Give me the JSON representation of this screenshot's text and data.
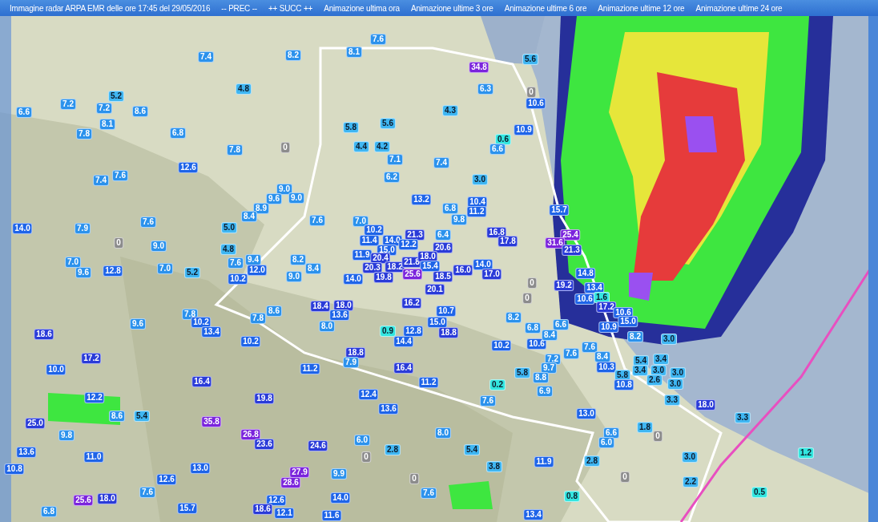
{
  "header": {
    "title": "Immagine radar ARPA EMR delle ore 17:45 del 29/05/2016",
    "links": [
      {
        "label": "-- PREC --"
      },
      {
        "label": "++ SUCC ++"
      },
      {
        "label": "Animazione ultima ora"
      },
      {
        "label": "Animazione ultime 3 ore"
      },
      {
        "label": "Animazione ultime 6 ore"
      },
      {
        "label": "Animazione ultime 12 ore"
      },
      {
        "label": "Animazione ultime 24 ore"
      }
    ]
  },
  "map": {
    "kind": "picture",
    "gauges": [
      {
        "value": "7.6",
        "color": "#2c92ec"
      },
      {
        "value": "7.4",
        "color": "#2c92ec"
      },
      {
        "value": "8.2",
        "color": "#2c92ec"
      },
      {
        "value": "8.1",
        "color": "#2c92ec"
      },
      {
        "value": "5.6",
        "color": "#3fb6f2"
      },
      {
        "value": "34.8",
        "color": "#7b24dc"
      },
      {
        "value": "5.2",
        "color": "#3fb6f2"
      },
      {
        "value": "4.8",
        "color": "#3fb6f2"
      },
      {
        "value": "6.3",
        "color": "#2c92ec"
      },
      {
        "value": "0",
        "color": "#8c8c8c"
      },
      {
        "value": "6.6",
        "color": "#2c92ec"
      },
      {
        "value": "7.2",
        "color": "#2c92ec"
      },
      {
        "value": "7.2",
        "color": "#2c92ec"
      },
      {
        "value": "8.6",
        "color": "#2c92ec"
      },
      {
        "value": "4.3",
        "color": "#3fb6f2"
      },
      {
        "value": "10.6",
        "color": "#1e64e8"
      },
      {
        "value": "7.8",
        "color": "#2c92ec"
      },
      {
        "value": "8.1",
        "color": "#2c92ec"
      },
      {
        "value": "6.8",
        "color": "#2c92ec"
      },
      {
        "value": "5.8",
        "color": "#3fb6f2"
      },
      {
        "value": "5.6",
        "color": "#3fb6f2"
      },
      {
        "value": "0.6",
        "color": "#33e6e0"
      },
      {
        "value": "10.9",
        "color": "#1e64e8"
      },
      {
        "value": "7.8",
        "color": "#2c92ec"
      },
      {
        "value": "0",
        "color": "#8c8c8c"
      },
      {
        "value": "4.4",
        "color": "#3fb6f2"
      },
      {
        "value": "4.2",
        "color": "#3fb6f2"
      },
      {
        "value": "6.6",
        "color": "#2c92ec"
      },
      {
        "value": "12.6",
        "color": "#1e64e8"
      },
      {
        "value": "7.1",
        "color": "#2c92ec"
      },
      {
        "value": "7.4",
        "color": "#2c92ec"
      },
      {
        "value": "7.4",
        "color": "#2c92ec"
      },
      {
        "value": "7.6",
        "color": "#2c92ec"
      },
      {
        "value": "6.2",
        "color": "#2c92ec"
      },
      {
        "value": "3.0",
        "color": "#3fb6f2"
      },
      {
        "value": "9.0",
        "color": "#2c92ec"
      },
      {
        "value": "9.6",
        "color": "#2c92ec"
      },
      {
        "value": "9.0",
        "color": "#2c92ec"
      },
      {
        "value": "13.2",
        "color": "#1e64e8"
      },
      {
        "value": "10.4",
        "color": "#1e64e8"
      },
      {
        "value": "8.9",
        "color": "#2c92ec"
      },
      {
        "value": "6.8",
        "color": "#2c92ec"
      },
      {
        "value": "11.2",
        "color": "#1e64e8"
      },
      {
        "value": "15.7",
        "color": "#1e64e8"
      },
      {
        "value": "7.6",
        "color": "#2c92ec"
      },
      {
        "value": "8.4",
        "color": "#2c92ec"
      },
      {
        "value": "7.6",
        "color": "#2c92ec"
      },
      {
        "value": "7.0",
        "color": "#2c92ec"
      },
      {
        "value": "9.8",
        "color": "#2c92ec"
      },
      {
        "value": "14.0",
        "color": "#1e64e8"
      },
      {
        "value": "7.9",
        "color": "#2c92ec"
      },
      {
        "value": "5.0",
        "color": "#3fb6f2"
      },
      {
        "value": "10.2",
        "color": "#1e64e8"
      },
      {
        "value": "21.3",
        "color": "#2a3bd8"
      },
      {
        "value": "6.4",
        "color": "#2c92ec"
      },
      {
        "value": "16.8",
        "color": "#2a3bd8"
      },
      {
        "value": "25.4",
        "color": "#7b24dc"
      },
      {
        "value": "0",
        "color": "#8c8c8c"
      },
      {
        "value": "9.0",
        "color": "#2c92ec"
      },
      {
        "value": "4.8",
        "color": "#3fb6f2"
      },
      {
        "value": "11.4",
        "color": "#1e64e8"
      },
      {
        "value": "14.0",
        "color": "#1e64e8"
      },
      {
        "value": "15.0",
        "color": "#1e64e8"
      },
      {
        "value": "12.2",
        "color": "#1e64e8"
      },
      {
        "value": "20.6",
        "color": "#2a3bd8"
      },
      {
        "value": "17.8",
        "color": "#2a3bd8"
      },
      {
        "value": "31.6",
        "color": "#7b24dc"
      },
      {
        "value": "21.3",
        "color": "#2a3bd8"
      },
      {
        "value": "7.0",
        "color": "#2c92ec"
      },
      {
        "value": "7.6",
        "color": "#2c92ec"
      },
      {
        "value": "9.4",
        "color": "#2c92ec"
      },
      {
        "value": "8.2",
        "color": "#2c92ec"
      },
      {
        "value": "11.9",
        "color": "#1e64e8"
      },
      {
        "value": "20.4",
        "color": "#2a3bd8"
      },
      {
        "value": "20.3",
        "color": "#2a3bd8"
      },
      {
        "value": "18.2",
        "color": "#2a3bd8"
      },
      {
        "value": "21.8",
        "color": "#2a3bd8"
      },
      {
        "value": "18.0",
        "color": "#2a3bd8"
      },
      {
        "value": "15.4",
        "color": "#1e64e8"
      },
      {
        "value": "14.0",
        "color": "#1e64e8"
      },
      {
        "value": "9.6",
        "color": "#2c92ec"
      },
      {
        "value": "12.8",
        "color": "#1e64e8"
      },
      {
        "value": "7.0",
        "color": "#2c92ec"
      },
      {
        "value": "5.2",
        "color": "#3fb6f2"
      },
      {
        "value": "12.0",
        "color": "#1e64e8"
      },
      {
        "value": "10.2",
        "color": "#1e64e8"
      },
      {
        "value": "9.0",
        "color": "#2c92ec"
      },
      {
        "value": "8.4",
        "color": "#2c92ec"
      },
      {
        "value": "14.0",
        "color": "#1e64e8"
      },
      {
        "value": "19.8",
        "color": "#2a3bd8"
      },
      {
        "value": "25.6",
        "color": "#7b24dc"
      },
      {
        "value": "16.0",
        "color": "#2a3bd8"
      },
      {
        "value": "18.5",
        "color": "#2a3bd8"
      },
      {
        "value": "17.0",
        "color": "#2a3bd8"
      },
      {
        "value": "14.8",
        "color": "#1e64e8"
      },
      {
        "value": "20.1",
        "color": "#2a3bd8"
      },
      {
        "value": "0",
        "color": "#8c8c8c"
      },
      {
        "value": "19.2",
        "color": "#2a3bd8"
      },
      {
        "value": "13.4",
        "color": "#1e64e8"
      },
      {
        "value": "16.2",
        "color": "#2a3bd8"
      },
      {
        "value": "0",
        "color": "#8c8c8c"
      },
      {
        "value": "10.6",
        "color": "#1e64e8"
      },
      {
        "value": "1.6",
        "color": "#33e6e0"
      },
      {
        "value": "8.6",
        "color": "#2c92ec"
      },
      {
        "value": "18.4",
        "color": "#2a3bd8"
      },
      {
        "value": "18.0",
        "color": "#2a3bd8"
      },
      {
        "value": "10.7",
        "color": "#1e64e8"
      },
      {
        "value": "17.2",
        "color": "#2a3bd8"
      },
      {
        "value": "7.8",
        "color": "#2c92ec"
      },
      {
        "value": "7.8",
        "color": "#2c92ec"
      },
      {
        "value": "13.6",
        "color": "#1e64e8"
      },
      {
        "value": "8.2",
        "color": "#2c92ec"
      },
      {
        "value": "10.6",
        "color": "#1e64e8"
      },
      {
        "value": "9.6",
        "color": "#2c92ec"
      },
      {
        "value": "10.2",
        "color": "#1e64e8"
      },
      {
        "value": "8.0",
        "color": "#2c92ec"
      },
      {
        "value": "15.0",
        "color": "#1e64e8"
      },
      {
        "value": "6.8",
        "color": "#2c92ec"
      },
      {
        "value": "6.6",
        "color": "#2c92ec"
      },
      {
        "value": "10.9",
        "color": "#1e64e8"
      },
      {
        "value": "15.0",
        "color": "#1e64e8"
      },
      {
        "value": "18.6",
        "color": "#2a3bd8"
      },
      {
        "value": "13.4",
        "color": "#1e64e8"
      },
      {
        "value": "10.2",
        "color": "#1e64e8"
      },
      {
        "value": "0.9",
        "color": "#33e6e0"
      },
      {
        "value": "12.8",
        "color": "#1e64e8"
      },
      {
        "value": "14.4",
        "color": "#1e64e8"
      },
      {
        "value": "18.8",
        "color": "#2a3bd8"
      },
      {
        "value": "10.2",
        "color": "#1e64e8"
      },
      {
        "value": "10.6",
        "color": "#1e64e8"
      },
      {
        "value": "8.4",
        "color": "#2c92ec"
      },
      {
        "value": "7.6",
        "color": "#2c92ec"
      },
      {
        "value": "8.2",
        "color": "#2c92ec"
      },
      {
        "value": "3.0",
        "color": "#3fb6f2"
      },
      {
        "value": "17.2",
        "color": "#2a3bd8"
      },
      {
        "value": "18.8",
        "color": "#2a3bd8"
      },
      {
        "value": "7.9",
        "color": "#2c92ec"
      },
      {
        "value": "7.2",
        "color": "#2c92ec"
      },
      {
        "value": "7.6",
        "color": "#2c92ec"
      },
      {
        "value": "8.4",
        "color": "#2c92ec"
      },
      {
        "value": "5.4",
        "color": "#3fb6f2"
      },
      {
        "value": "3.4",
        "color": "#3fb6f2"
      },
      {
        "value": "10.0",
        "color": "#1e64e8"
      },
      {
        "value": "11.2",
        "color": "#1e64e8"
      },
      {
        "value": "16.4",
        "color": "#2a3bd8"
      },
      {
        "value": "5.8",
        "color": "#3fb6f2"
      },
      {
        "value": "9.7",
        "color": "#2c92ec"
      },
      {
        "value": "10.3",
        "color": "#1e64e8"
      },
      {
        "value": "3.4",
        "color": "#3fb6f2"
      },
      {
        "value": "3.0",
        "color": "#3fb6f2"
      },
      {
        "value": "3.0",
        "color": "#3fb6f2"
      },
      {
        "value": "16.4",
        "color": "#2a3bd8"
      },
      {
        "value": "11.2",
        "color": "#1e64e8"
      },
      {
        "value": "0.2",
        "color": "#33e6e0"
      },
      {
        "value": "8.8",
        "color": "#2c92ec"
      },
      {
        "value": "5.8",
        "color": "#3fb6f2"
      },
      {
        "value": "10.8",
        "color": "#1e64e8"
      },
      {
        "value": "2.6",
        "color": "#3fb6f2"
      },
      {
        "value": "3.0",
        "color": "#3fb6f2"
      },
      {
        "value": "12.2",
        "color": "#1e64e8"
      },
      {
        "value": "19.8",
        "color": "#2a3bd8"
      },
      {
        "value": "12.4",
        "color": "#1e64e8"
      },
      {
        "value": "7.6",
        "color": "#2c92ec"
      },
      {
        "value": "6.9",
        "color": "#2c92ec"
      },
      {
        "value": "3.3",
        "color": "#3fb6f2"
      },
      {
        "value": "13.6",
        "color": "#1e64e8"
      },
      {
        "value": "18.0",
        "color": "#2a3bd8"
      },
      {
        "value": "25.0",
        "color": "#2a3bd8"
      },
      {
        "value": "8.6",
        "color": "#2c92ec"
      },
      {
        "value": "5.4",
        "color": "#3fb6f2"
      },
      {
        "value": "35.8",
        "color": "#7b24dc"
      },
      {
        "value": "13.0",
        "color": "#1e64e8"
      },
      {
        "value": "3.3",
        "color": "#3fb6f2"
      },
      {
        "value": "9.8",
        "color": "#2c92ec"
      },
      {
        "value": "26.8",
        "color": "#7b24dc"
      },
      {
        "value": "8.0",
        "color": "#2c92ec"
      },
      {
        "value": "6.6",
        "color": "#2c92ec"
      },
      {
        "value": "1.8",
        "color": "#3fb6f2"
      },
      {
        "value": "0",
        "color": "#8c8c8c"
      },
      {
        "value": "23.6",
        "color": "#2a3bd8"
      },
      {
        "value": "24.6",
        "color": "#2a3bd8"
      },
      {
        "value": "6.0",
        "color": "#2c92ec"
      },
      {
        "value": "6.0",
        "color": "#2c92ec"
      },
      {
        "value": "13.6",
        "color": "#1e64e8"
      },
      {
        "value": "11.0",
        "color": "#1e64e8"
      },
      {
        "value": "0",
        "color": "#8c8c8c"
      },
      {
        "value": "2.8",
        "color": "#3fb6f2"
      },
      {
        "value": "5.4",
        "color": "#3fb6f2"
      },
      {
        "value": "3.0",
        "color": "#3fb6f2"
      },
      {
        "value": "1.2",
        "color": "#33e6e0"
      },
      {
        "value": "10.8",
        "color": "#1e64e8"
      },
      {
        "value": "13.0",
        "color": "#1e64e8"
      },
      {
        "value": "3.8",
        "color": "#3fb6f2"
      },
      {
        "value": "11.9",
        "color": "#1e64e8"
      },
      {
        "value": "2.8",
        "color": "#3fb6f2"
      },
      {
        "value": "12.6",
        "color": "#1e64e8"
      },
      {
        "value": "27.9",
        "color": "#7b24dc"
      },
      {
        "value": "28.6",
        "color": "#7b24dc"
      },
      {
        "value": "9.9",
        "color": "#2c92ec"
      },
      {
        "value": "0",
        "color": "#8c8c8c"
      },
      {
        "value": "0",
        "color": "#8c8c8c"
      },
      {
        "value": "2.2",
        "color": "#3fb6f2"
      },
      {
        "value": "25.6",
        "color": "#7b24dc"
      },
      {
        "value": "18.0",
        "color": "#2a3bd8"
      },
      {
        "value": "7.6",
        "color": "#2c92ec"
      },
      {
        "value": "12.6",
        "color": "#1e64e8"
      },
      {
        "value": "14.0",
        "color": "#1e64e8"
      },
      {
        "value": "7.6",
        "color": "#2c92ec"
      },
      {
        "value": "0.8",
        "color": "#33e6e0"
      },
      {
        "value": "0.5",
        "color": "#33e6e0"
      },
      {
        "value": "6.8",
        "color": "#2c92ec"
      },
      {
        "value": "15.7",
        "color": "#1e64e8"
      },
      {
        "value": "18.6",
        "color": "#2a3bd8"
      },
      {
        "value": "12.1",
        "color": "#1e64e8"
      },
      {
        "value": "11.6",
        "color": "#1e64e8"
      },
      {
        "value": "13.4",
        "color": "#1e64e8"
      }
    ]
  }
}
